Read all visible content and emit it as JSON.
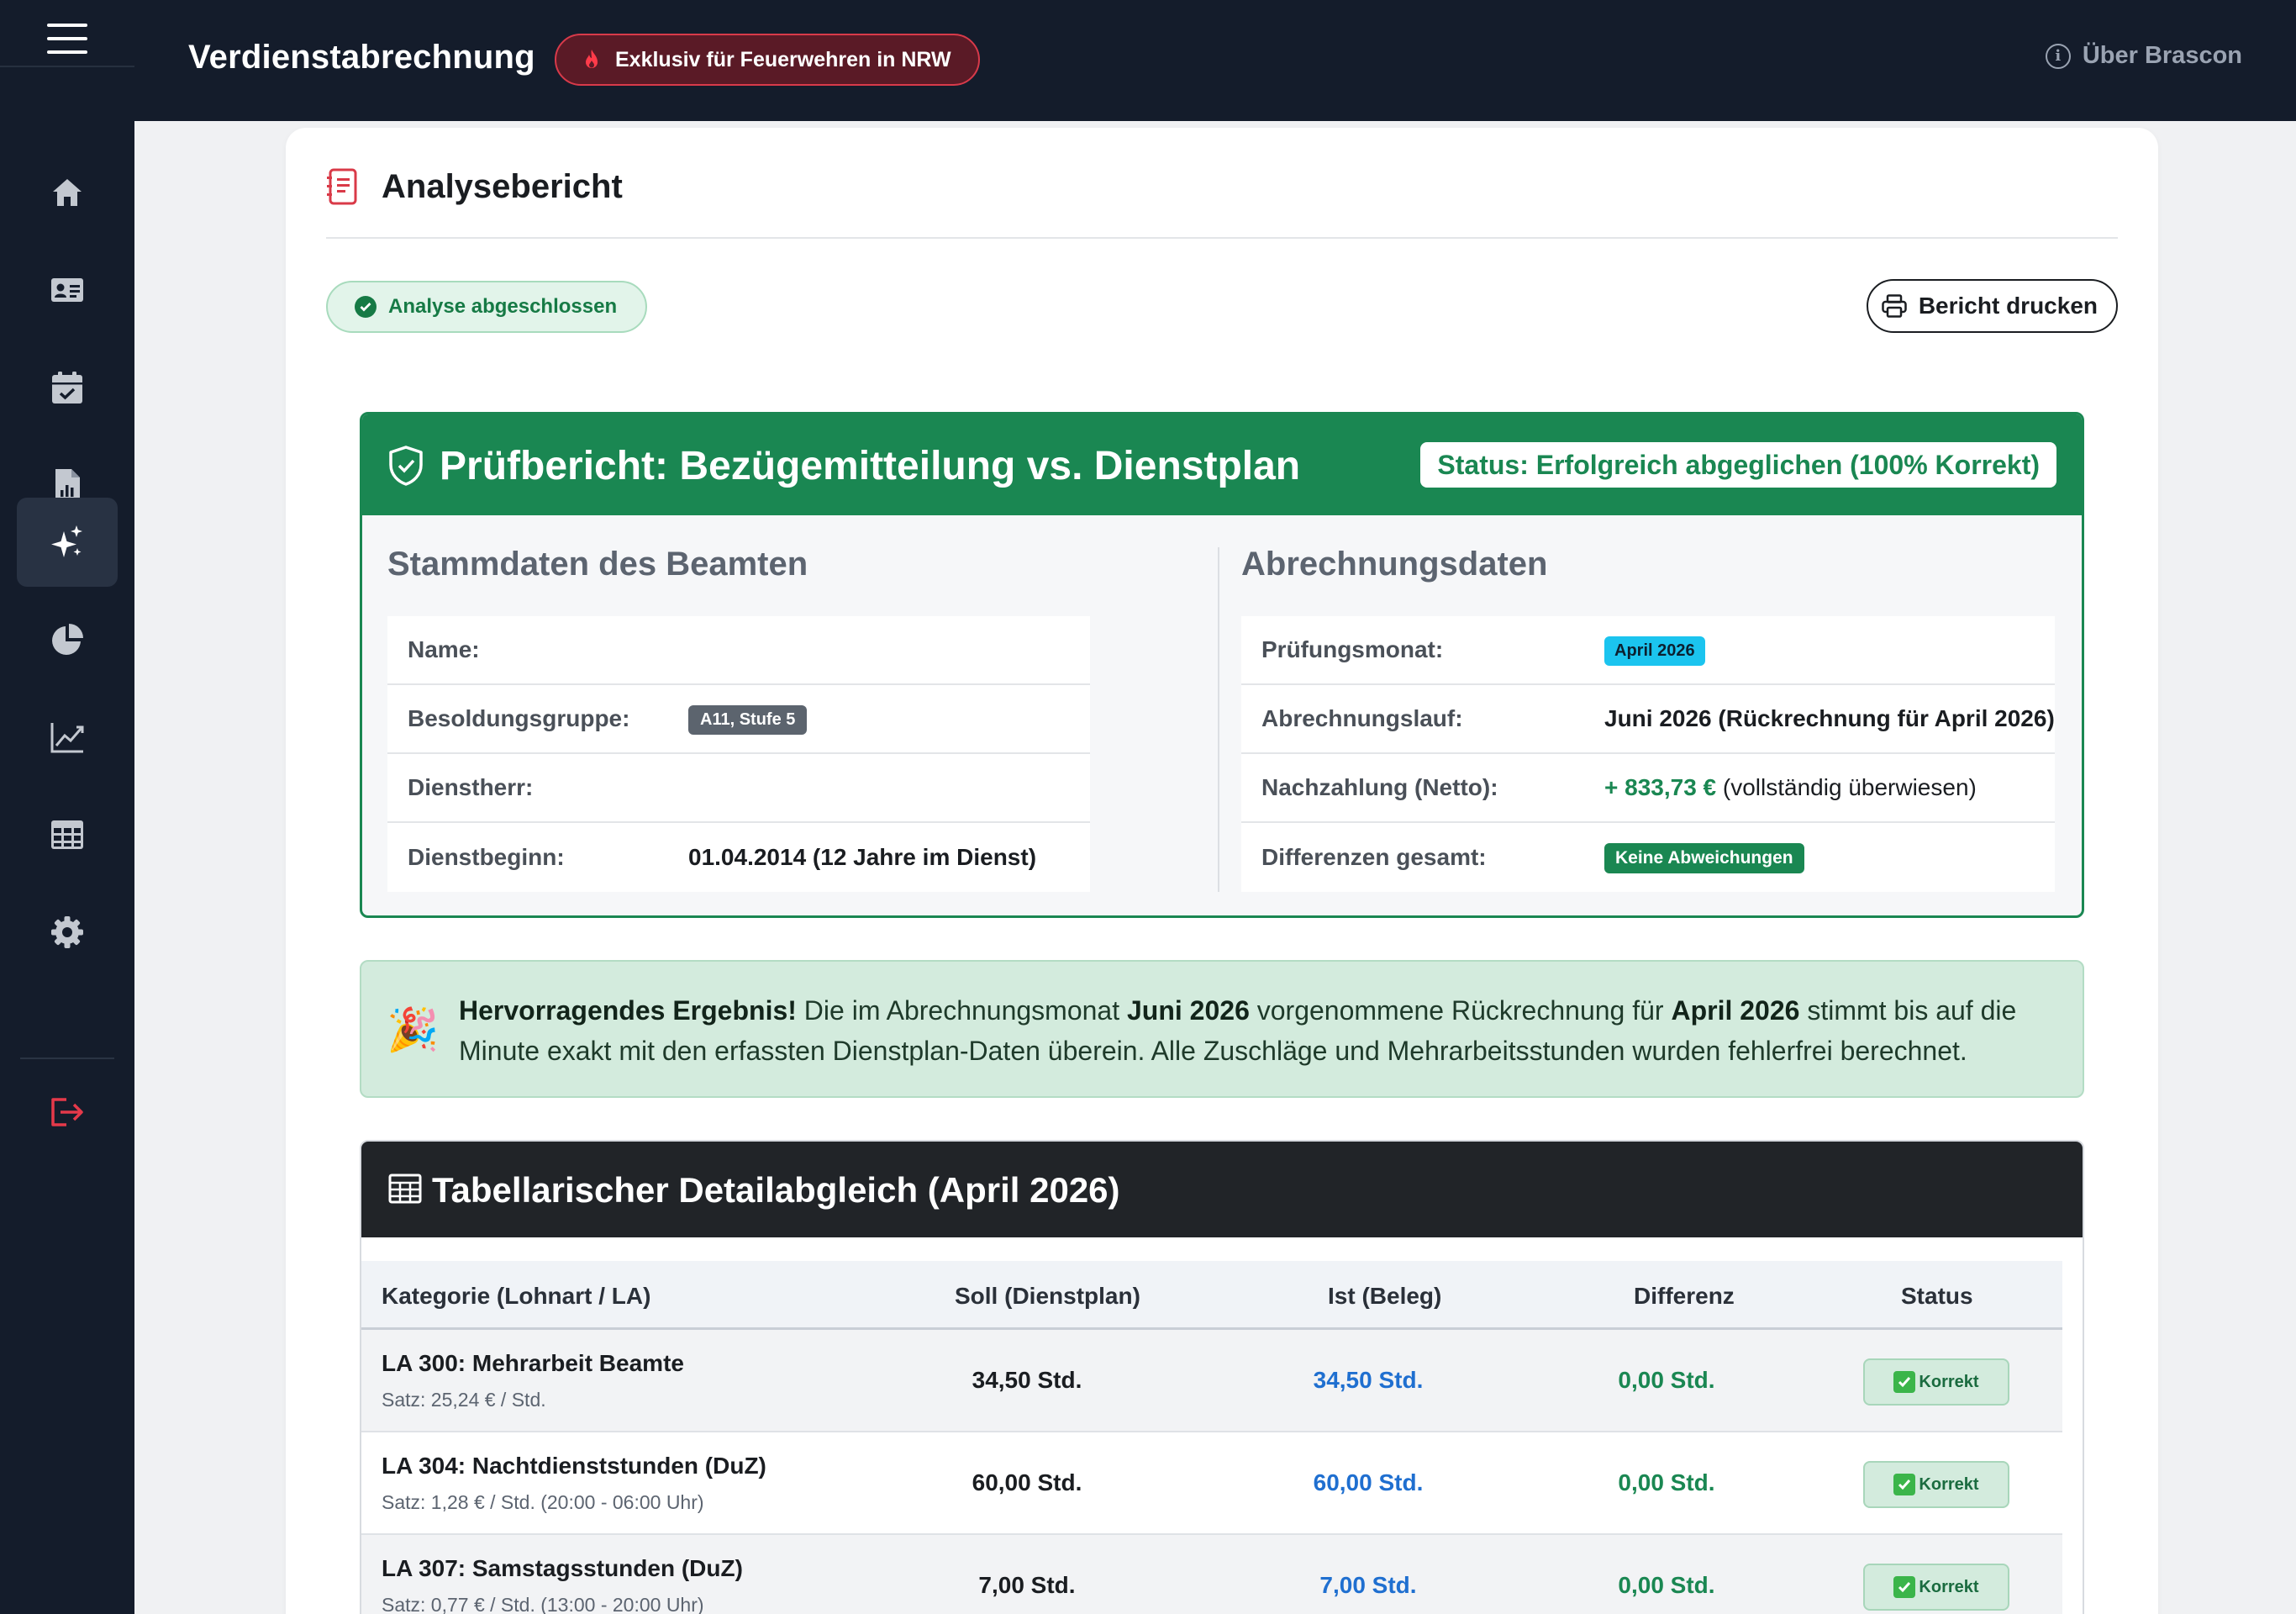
{
  "header": {
    "app_title": "Verdienstabrechnung",
    "exclusive_badge": "Exklusiv für Feuerwehren in NRW",
    "about_link": "Über Brascon"
  },
  "sidebar": {
    "items": [
      {
        "icon": "home-icon",
        "active": false
      },
      {
        "icon": "id-card-icon",
        "active": false
      },
      {
        "icon": "calendar-check-icon",
        "active": false
      },
      {
        "icon": "file-chart-icon",
        "active": false
      },
      {
        "icon": "sparkles-icon",
        "active": true
      },
      {
        "icon": "pie-chart-icon",
        "active": false
      },
      {
        "icon": "line-chart-icon",
        "active": false
      },
      {
        "icon": "table-icon",
        "active": false
      },
      {
        "icon": "gear-icon",
        "active": false
      },
      {
        "icon": "logout-icon",
        "active": false
      }
    ]
  },
  "main": {
    "card_title": "Analysebericht",
    "status_pill": "Analyse abgeschlossen",
    "print_button": "Bericht drucken"
  },
  "report": {
    "title": "Prüfbericht: Bezügemitteilung vs. Dienstplan",
    "status": "Status: Erfolgreich abgeglichen (100% Korrekt)",
    "master_title": "Stammdaten des Beamten",
    "master": {
      "name_label": "Name:",
      "name_value": "",
      "grade_label": "Besoldungsgruppe:",
      "grade_value": "A11, Stufe 5",
      "employer_label": "Dienstherr:",
      "employer_value": "",
      "start_label": "Dienstbeginn:",
      "start_value": "01.04.2014 (12 Jahre im Dienst)"
    },
    "billing_title": "Abrechnungsdaten",
    "billing": {
      "month_label": "Prüfungsmonat:",
      "month_value": "April 2026",
      "run_label": "Abrechnungslauf:",
      "run_value": "Juni 2026 (Rückrechnung für April 2026)",
      "payment_label": "Nachzahlung (Netto):",
      "payment_amount": "+ 833,73 €",
      "payment_note": "(vollständig überwiesen)",
      "diff_label": "Differenzen gesamt:",
      "diff_value": "Keine Abweichungen"
    }
  },
  "success": {
    "lead": "Hervorragendes Ergebnis!",
    "t1": " Die im Abrechnungsmonat ",
    "b1": "Juni 2026",
    "t2": " vorgenommene Rückrechnung für ",
    "b2": "April 2026",
    "t3": " stimmt bis auf die Minute exakt mit den erfassten Dienstplan-Daten überein. Alle Zuschläge und Mehrarbeitsstunden wurden fehlerfrei berechnet."
  },
  "detail": {
    "title": "Tabellarischer Detailabgleich (April 2026)",
    "columns": [
      "Kategorie (Lohnart / LA)",
      "Soll (Dienstplan)",
      "Ist (Beleg)",
      "Differenz",
      "Status"
    ],
    "rows": [
      {
        "name": "LA 300: Mehrarbeit Beamte",
        "rate": "Satz: 25,24 € / Std.",
        "soll": "34,50 Std.",
        "ist": "34,50 Std.",
        "diff": "0,00 Std.",
        "status": "Korrekt"
      },
      {
        "name": "LA 304: Nachtdienststunden (DuZ)",
        "rate": "Satz: 1,28 € / Std. (20:00 - 06:00 Uhr)",
        "soll": "60,00 Std.",
        "ist": "60,00 Std.",
        "diff": "0,00 Std.",
        "status": "Korrekt"
      },
      {
        "name": "LA 307: Samstagsstunden (DuZ)",
        "rate": "Satz: 0,77 € / Std. (13:00 - 20:00 Uhr)",
        "soll": "7,00 Std.",
        "ist": "7,00 Std.",
        "diff": "0,00 Std.",
        "status": "Korrekt"
      }
    ]
  }
}
